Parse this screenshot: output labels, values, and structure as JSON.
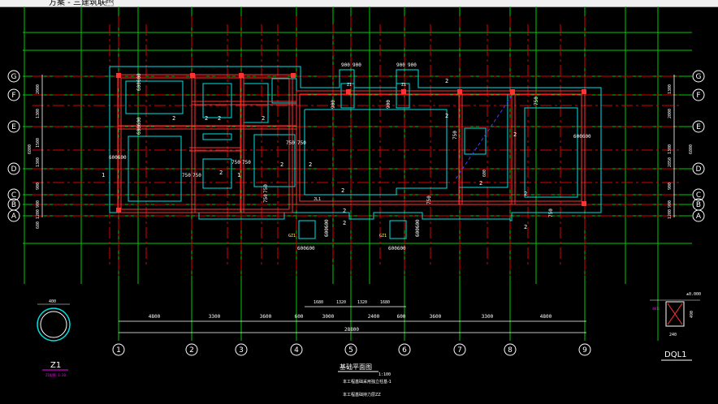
{
  "window": {
    "tab_text": "方案 - 三建筑联\u0002"
  },
  "grid": {
    "rows": [
      "G",
      "F",
      "E",
      "D",
      "C",
      "B",
      "A"
    ],
    "cols": [
      "1",
      "2",
      "3",
      "4",
      "5",
      "6",
      "7",
      "8",
      "9"
    ],
    "left_dims": [
      "2000",
      "1300",
      "1500",
      "1300",
      "900",
      "900",
      "1200",
      "680",
      "6800"
    ],
    "right_dims": [
      "1300",
      "2000",
      "1300",
      "2850",
      "900",
      "900",
      "1200",
      "6800"
    ],
    "bottom_dims": [
      "4800",
      "3300",
      "3600",
      "600",
      "3000",
      "2400",
      "600",
      "3600",
      "3300",
      "4800"
    ],
    "bottom_total": "28800",
    "mid_dims": [
      "1680",
      "1320",
      "1320",
      "1680"
    ]
  },
  "plan_labels": {
    "two": "2",
    "one": "1",
    "d750": "750",
    "d600": "600",
    "d900": "900",
    "d6000": "600600",
    "d400": "600600",
    "jl1": "JL1",
    "gz1": "GZ1",
    "z1": "Z1"
  },
  "title_block": {
    "title": "基础平面图",
    "scale": "1:100",
    "note1": "本工程基础采用独立柱基-1",
    "note2": "本工程基础持力层ZZ"
  },
  "detail_z1": {
    "dim": "400",
    "label": "Z1",
    "sub": "Z1配筋 1:20"
  },
  "detail_dql1": {
    "label": "DQL1",
    "elev": "±0.000",
    "dim_h": "490",
    "dim_w": "240",
    "sub": "4Φ12"
  }
}
